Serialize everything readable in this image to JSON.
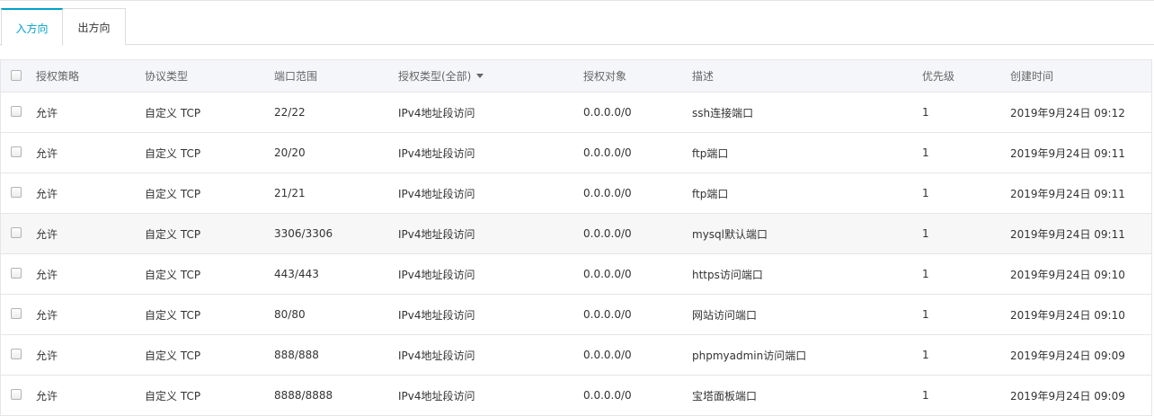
{
  "tabs": [
    {
      "label": "入方向",
      "active": true
    },
    {
      "label": "出方向",
      "active": false
    }
  ],
  "columns": {
    "policy": "授权策略",
    "protocol": "协议类型",
    "port_range": "端口范围",
    "auth_type": "授权类型(全部)",
    "auth_object": "授权对象",
    "description": "描述",
    "priority": "优先级",
    "created": "创建时间"
  },
  "rows": [
    {
      "policy": "允许",
      "protocol": "自定义 TCP",
      "port_range": "22/22",
      "auth_type": "IPv4地址段访问",
      "auth_object": "0.0.0.0/0",
      "description": "ssh连接端口",
      "priority": "1",
      "created": "2019年9月24日 09:12"
    },
    {
      "policy": "允许",
      "protocol": "自定义 TCP",
      "port_range": "20/20",
      "auth_type": "IPv4地址段访问",
      "auth_object": "0.0.0.0/0",
      "description": "ftp端口",
      "priority": "1",
      "created": "2019年9月24日 09:11"
    },
    {
      "policy": "允许",
      "protocol": "自定义 TCP",
      "port_range": "21/21",
      "auth_type": "IPv4地址段访问",
      "auth_object": "0.0.0.0/0",
      "description": "ftp端口",
      "priority": "1",
      "created": "2019年9月24日 09:11"
    },
    {
      "policy": "允许",
      "protocol": "自定义 TCP",
      "port_range": "3306/3306",
      "auth_type": "IPv4地址段访问",
      "auth_object": "0.0.0.0/0",
      "description": "mysql默认端口",
      "priority": "1",
      "created": "2019年9月24日 09:11"
    },
    {
      "policy": "允许",
      "protocol": "自定义 TCP",
      "port_range": "443/443",
      "auth_type": "IPv4地址段访问",
      "auth_object": "0.0.0.0/0",
      "description": "https访问端口",
      "priority": "1",
      "created": "2019年9月24日 09:10"
    },
    {
      "policy": "允许",
      "protocol": "自定义 TCP",
      "port_range": "80/80",
      "auth_type": "IPv4地址段访问",
      "auth_object": "0.0.0.0/0",
      "description": "网站访问端口",
      "priority": "1",
      "created": "2019年9月24日 09:10"
    },
    {
      "policy": "允许",
      "protocol": "自定义 TCP",
      "port_range": "888/888",
      "auth_type": "IPv4地址段访问",
      "auth_object": "0.0.0.0/0",
      "description": "phpmyadmin访问端口",
      "priority": "1",
      "created": "2019年9月24日 09:09"
    },
    {
      "policy": "允许",
      "protocol": "自定义 TCP",
      "port_range": "8888/8888",
      "auth_type": "IPv4地址段访问",
      "auth_object": "0.0.0.0/0",
      "description": "宝塔面板端口",
      "priority": "1",
      "created": "2019年9月24日 09:09"
    }
  ],
  "colors": {
    "accent": "#00a2ca",
    "header_bg": "#f5f6fa",
    "border": "#e6e6e6",
    "highlight_row": "#f7f7f7"
  }
}
